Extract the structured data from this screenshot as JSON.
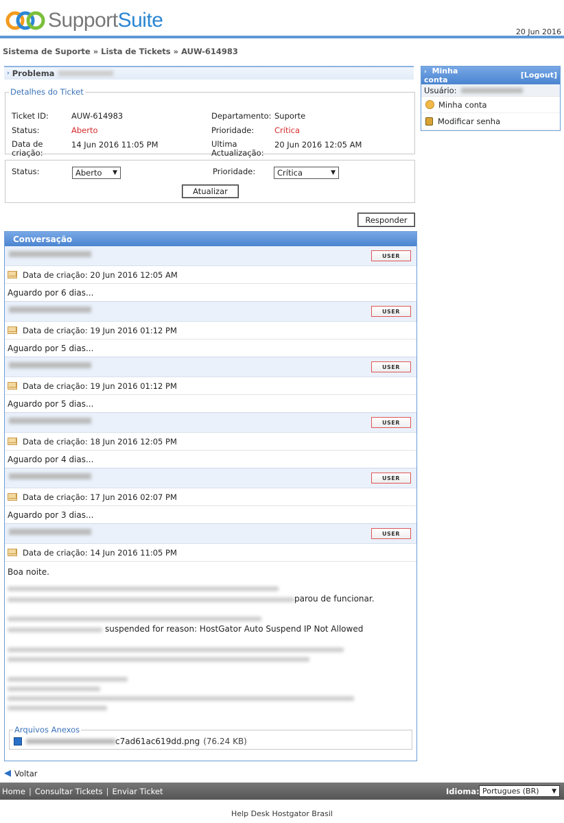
{
  "header": {
    "logo_part1": "Support",
    "logo_part2": "Suite",
    "date": "20 Jun 2016"
  },
  "breadcrumb": "Sistema de Suporte » Lista de Tickets » AUW-614983",
  "problem": {
    "label": "Problema"
  },
  "details": {
    "legend": "Detalhes do Ticket",
    "ticket_id_label": "Ticket ID:",
    "ticket_id": "AUW-614983",
    "department_label": "Departamento:",
    "department": "Suporte",
    "status_label": "Status:",
    "status": "Aberto",
    "priority_label": "Prioridade:",
    "priority": "Crítica",
    "created_label_1": "Data de",
    "created_label_2": "criação:",
    "created": "14 Jun 2016 11:05 PM",
    "updated_label_1": "Ultima",
    "updated_label_2": "Actualização:",
    "updated": "20 Jun 2016 12:05 AM"
  },
  "update_form": {
    "status_label": "Status:",
    "status_value": "Aberto",
    "priority_label": "Prioridade:",
    "priority_value": "Crítica",
    "submit_label": "Atualizar"
  },
  "reply_label": "Responder",
  "conversation": {
    "title": "Conversação",
    "user_badge": "USER",
    "entries": [
      {
        "date": "Data de criação: 20 Jun 2016 12:05 AM",
        "body": "Aguardo por 6 dias..."
      },
      {
        "date": "Data de criação: 19 Jun 2016 01:12 PM",
        "body": "Aguardo por 5 dias..."
      },
      {
        "date": "Data de criação: 19 Jun 2016 01:12 PM",
        "body": "Aguardo por 5 dias..."
      },
      {
        "date": "Data de criação: 18 Jun 2016 12:05 PM",
        "body": "Aguardo por 4 dias..."
      },
      {
        "date": "Data de criação: 17 Jun 2016 02:07 PM",
        "body": "Aguardo por 3 dias..."
      }
    ],
    "last_entry": {
      "date": "Data de criação: 14 Jun 2016 11:05 PM",
      "greeting": "Boa noite.",
      "fragment1": "parou de funcionar.",
      "fragment2": "suspended for reason: HostGator Auto Suspend IP Not Allowed",
      "attachments_legend": "Arquivos Anexos",
      "attachment_name": "c7ad61ac619dd.png",
      "attachment_size": "(76.24 KB)"
    }
  },
  "account": {
    "title": "Minha conta",
    "logout": "[Logout]",
    "user_label": "Usuário:",
    "my_account": "Minha conta",
    "change_password": "Modificar senha"
  },
  "back_label": "Voltar",
  "footer": {
    "home": "Home",
    "view_tickets": "Consultar Tickets",
    "submit_ticket": "Enviar Ticket",
    "language_label": "Idioma:",
    "language_value": "Portugues (BR)",
    "copyright": "Help Desk Hostgator Brasil"
  },
  "colors": {
    "accent": "#4a84d0",
    "critical": "#d62b2b",
    "footer": "#666666"
  }
}
